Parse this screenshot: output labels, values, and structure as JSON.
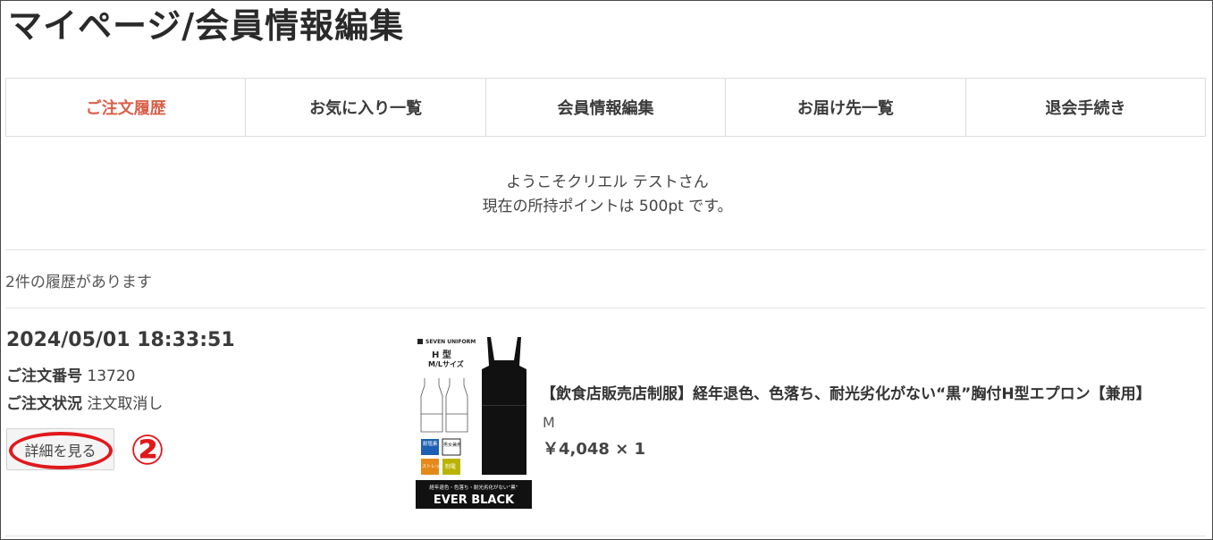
{
  "page": {
    "title": "マイページ/会員情報編集"
  },
  "tabs": [
    {
      "label": "ご注文履歴",
      "active": true
    },
    {
      "label": "お気に入り一覧",
      "active": false
    },
    {
      "label": "会員情報編集",
      "active": false
    },
    {
      "label": "お届け先一覧",
      "active": false
    },
    {
      "label": "退会手続き",
      "active": false
    }
  ],
  "welcome": {
    "greeting": "ようこそクリエル テストさん",
    "points": "現在の所持ポイントは 500pt です。"
  },
  "history": {
    "count_text": "2件の履歴があります",
    "orders": [
      {
        "datetime": "2024/05/01 18:33:51",
        "number_label": "ご注文番号",
        "number": "13720",
        "status_label": "ご注文状況",
        "status": "注文取消し",
        "detail_button": "詳細を見る",
        "annotation": "②",
        "item": {
          "name": "【飲食店販売店制服】経年退色、色落ち、耐光劣化がない“黒”胸付H型エプロン【兼用】",
          "size": "M",
          "price": "￥4,048 × 1",
          "image_text": {
            "brand": "SEVEN UNIFORM",
            "type": "H 型",
            "sizes": "M/Lサイズ",
            "badge1": "耐塩素",
            "badge2": "男女兼用",
            "badge3": "ストレッチ",
            "badge4": "制電",
            "tagline": "経年退色・色落ち・耐光劣化がない“黒”",
            "logo": "EVER BLACK"
          }
        }
      }
    ]
  },
  "colors": {
    "accent": "#d9604a",
    "annotation_red": "#e0181b",
    "border": "#dcdcdc"
  }
}
